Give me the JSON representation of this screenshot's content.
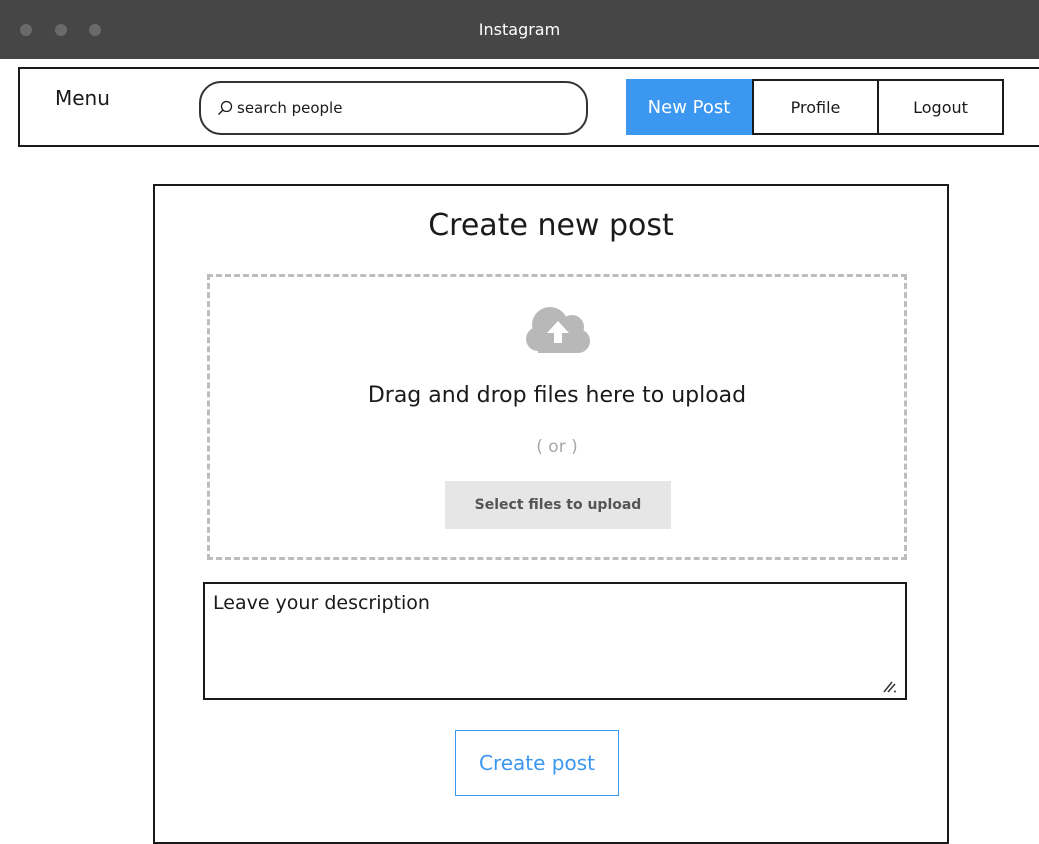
{
  "window": {
    "title": "Instagram"
  },
  "navbar": {
    "menu_label": "Menu",
    "search": {
      "placeholder": "search people",
      "icon": "search-icon"
    },
    "new_post_label": "New Post",
    "profile_label": "Profile",
    "logout_label": "Logout",
    "accent_color": "#3b97f0"
  },
  "post_form": {
    "title": "Create new post",
    "dropzone": {
      "icon": "cloud-upload-icon",
      "text": "Drag and drop files here to upload",
      "or_text": "( or )",
      "select_button_label": "Select files to upload"
    },
    "description": {
      "placeholder": "Leave your description"
    },
    "submit_label": "Create post"
  }
}
